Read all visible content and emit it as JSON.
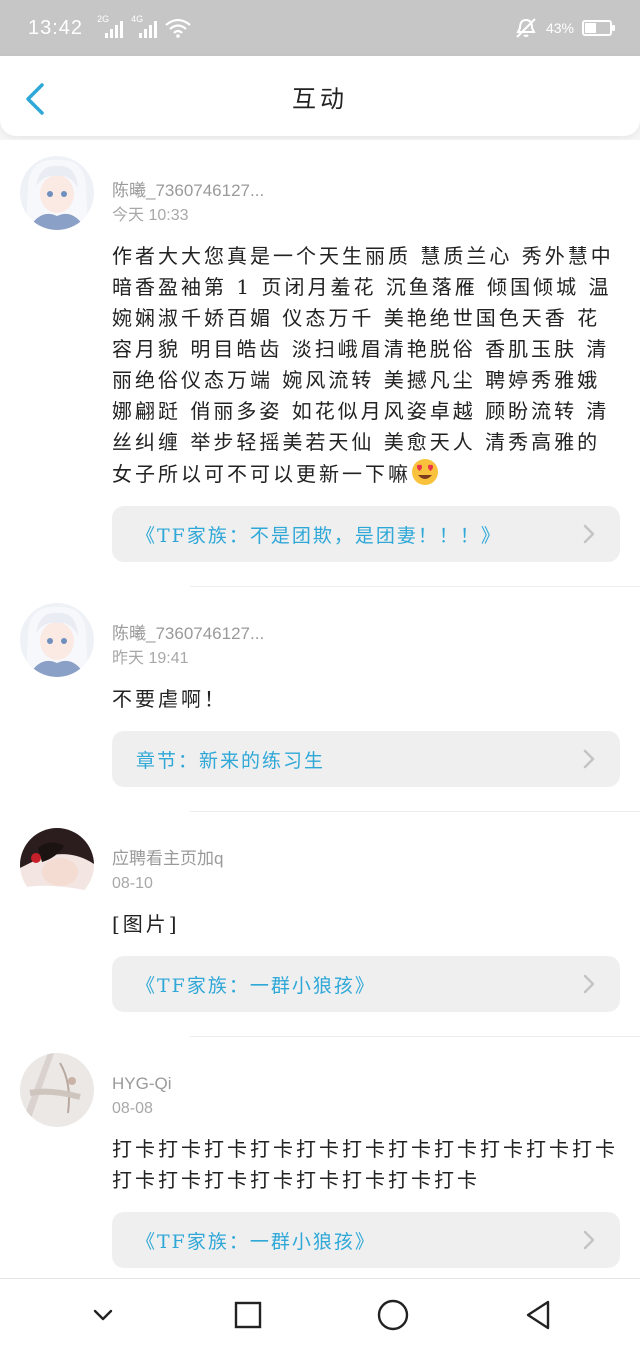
{
  "status_bar": {
    "time": "13:42",
    "sim1_label": "2G",
    "sim2_label": "4G",
    "battery_text": "43%",
    "battery_level": 0.43,
    "icons": [
      "signal-icon",
      "wifi-icon",
      "mute-bell-icon",
      "battery-icon"
    ]
  },
  "header": {
    "title": "互动",
    "back_icon": "back-chevron-icon"
  },
  "colors": {
    "accent": "#2fa8d8",
    "status_bar_bg": "#c6c6c6",
    "meta_text": "#9a9a9a",
    "card_bg": "#efefef"
  },
  "comments": [
    {
      "user": "陈曦_7360746127...",
      "time": "今天 10:33",
      "text": "作者大大您真是一个天生丽质 慧质兰心 秀外慧中 暗香盈袖第 1 页闭月羞花 沉鱼落雁 倾国倾城 温婉娴淑千娇百媚 仪态万千 美艳绝世国色天香 花容月貌 明目皓齿 淡扫峨眉清艳脱俗 香肌玉肤 清丽绝俗仪态万端 婉风流转 美撼凡尘 聘婷秀雅娥娜翩跹 俏丽多姿 如花似月风姿卓越 顾盼流转 清丝纠缠 举步轻摇美若天仙 美愈天人 清秀高雅的女子所以可不可以更新一下嘛",
      "emoji": "heart-eyes-emoji",
      "ref": "《TF家族：不是团欺，是团妻！！！》"
    },
    {
      "user": "陈曦_7360746127...",
      "time": "昨天 19:41",
      "text": "不要虐啊！",
      "ref": "章节：新来的练习生"
    },
    {
      "user": "应聘看主页加q",
      "time": "08-10",
      "text": "[图片]",
      "ref": "《TF家族：一群小狼孩》"
    },
    {
      "user": "HYG-Qi",
      "time": "08-08",
      "text": "打卡打卡打卡打卡打卡打卡打卡打卡打卡打卡打卡打卡打卡打卡打卡打卡打卡打卡打卡",
      "ref": "《TF家族：一群小狼孩》"
    }
  ],
  "nav_bar": {
    "icons": [
      "nav-collapse-icon",
      "recent-apps-icon",
      "home-icon",
      "back-triangle-icon"
    ]
  }
}
